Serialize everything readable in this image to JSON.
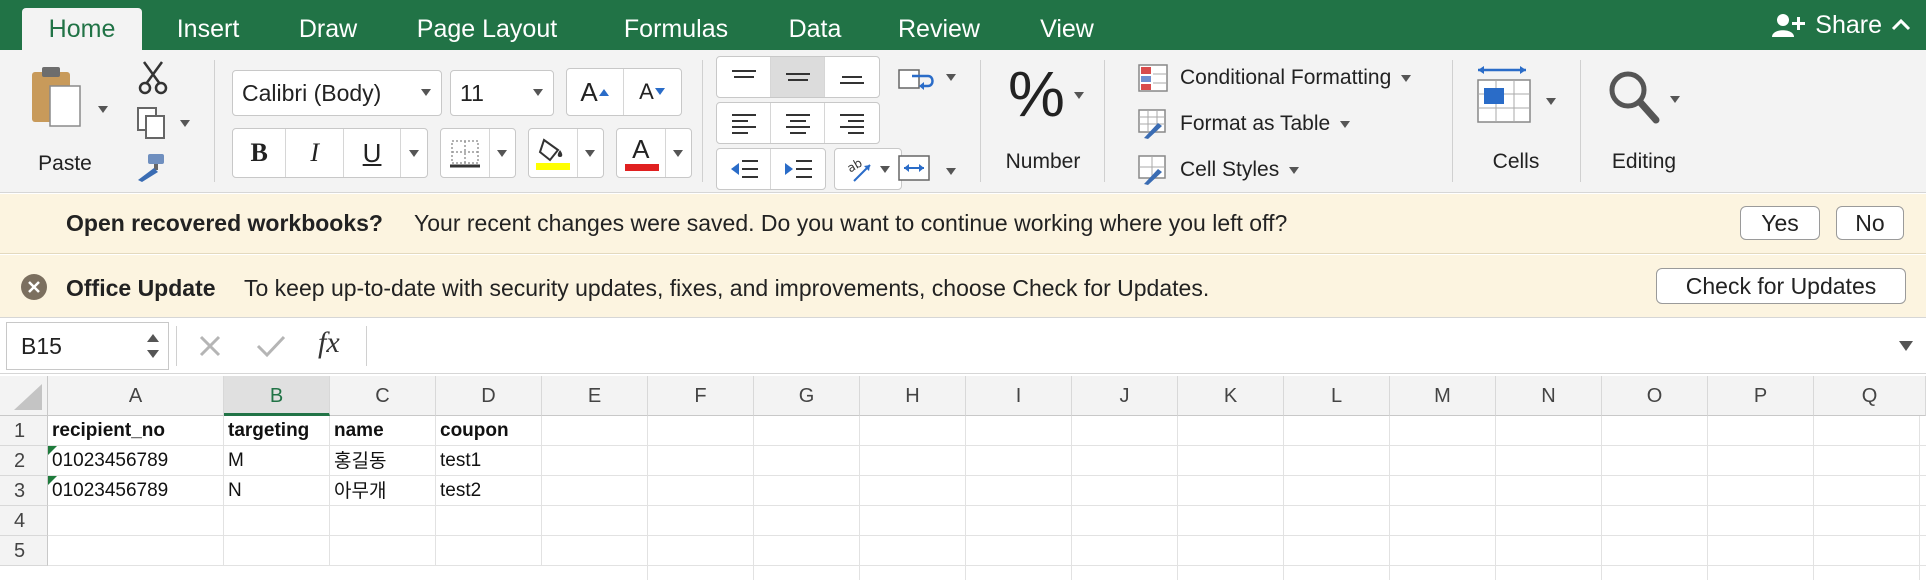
{
  "tabs": [
    "Home",
    "Insert",
    "Draw",
    "Page Layout",
    "Formulas",
    "Data",
    "Review",
    "View"
  ],
  "active_tab": "Home",
  "share_label": "Share",
  "ribbon": {
    "paste_label": "Paste",
    "font_name": "Calibri (Body)",
    "font_size": "11",
    "number_label": "Number",
    "number_symbol": "%",
    "conditional_formatting": "Conditional Formatting",
    "format_as_table": "Format as Table",
    "cell_styles": "Cell Styles",
    "cells_label": "Cells",
    "editing_label": "Editing",
    "bold": "B",
    "italic": "I",
    "underline": "U",
    "font_color_letter": "A",
    "grow_font": "A",
    "shrink_font": "A"
  },
  "recovery_bar": {
    "title": "Open recovered workbooks?",
    "message": "Your recent changes were saved. Do you want to continue working where you left off?",
    "yes": "Yes",
    "no": "No"
  },
  "update_bar": {
    "title": "Office Update",
    "message": "To keep up-to-date with security updates, fixes, and improvements, choose Check for Updates.",
    "button": "Check for Updates"
  },
  "formula_bar": {
    "name_box": "B15",
    "fx": "fx",
    "formula": ""
  },
  "columns": [
    "A",
    "B",
    "C",
    "D",
    "E",
    "F",
    "G",
    "H",
    "I",
    "J",
    "K",
    "L",
    "M",
    "N",
    "O",
    "P",
    "Q"
  ],
  "selected_column": "B",
  "row_numbers": [
    "1",
    "2",
    "3",
    "4",
    "5"
  ],
  "rows": [
    [
      "recipient_no",
      "targeting",
      "name",
      "coupon"
    ],
    [
      "01023456789",
      "M",
      "홍길동",
      "test1"
    ],
    [
      "01023456789",
      "N",
      "아무개",
      "test2"
    ],
    [
      "",
      "",
      "",
      ""
    ],
    [
      "",
      "",
      "",
      ""
    ]
  ],
  "colors": {
    "accent": "#217346",
    "tab_bar": "#217346",
    "message_bar": "#fcf4e0",
    "font_color_bar": "#e02020",
    "highlight_bar": "#ffff00"
  }
}
